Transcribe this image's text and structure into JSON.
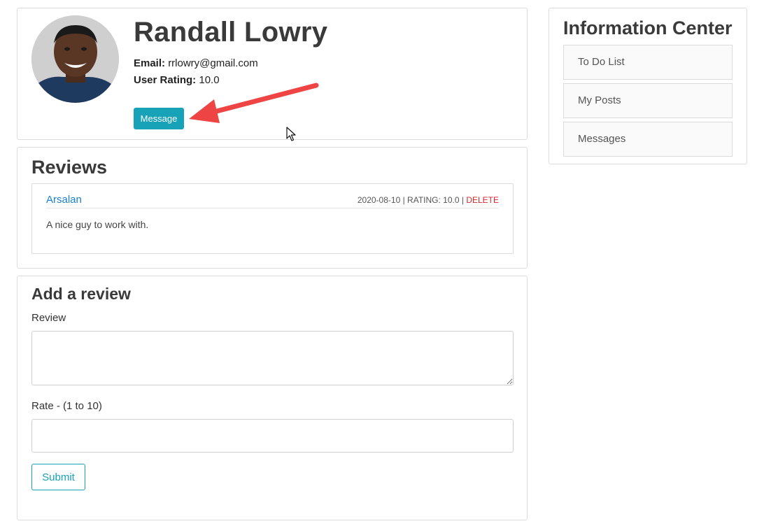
{
  "profile": {
    "name": "Randall Lowry",
    "email_label": "Email:",
    "email": "rrlowry@gmail.com",
    "rating_label": "User Rating:",
    "rating": "10.0",
    "message_button": "Message"
  },
  "reviews": {
    "title": "Reviews",
    "items": [
      {
        "author": "Arsalan",
        "date": "2020-08-10",
        "rating_text": "RATING: 10.0",
        "delete_label": "DELETE",
        "text": "A nice guy to work with."
      }
    ]
  },
  "add_review": {
    "title": "Add a review",
    "review_label": "Review",
    "review_value": "",
    "rate_label": "Rate - (1 to 10)",
    "rate_value": "",
    "submit_label": "Submit"
  },
  "info_center": {
    "title": "Information Center",
    "items": [
      {
        "label": "To Do List"
      },
      {
        "label": "My Posts"
      },
      {
        "label": "Messages"
      }
    ]
  },
  "colors": {
    "accent": "#17a2b8",
    "link": "#1a7fd3",
    "delete": "#d9262c",
    "annotation_arrow": "#ef4444"
  },
  "icons": [
    "avatar-photo",
    "annotation-arrow",
    "mouse-cursor-icon"
  ]
}
